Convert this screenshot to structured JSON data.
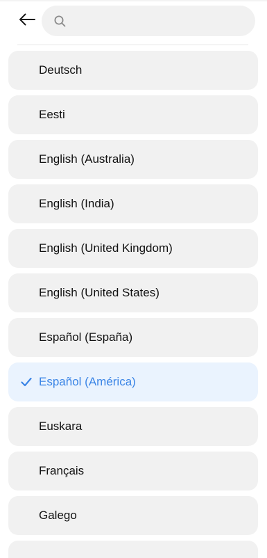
{
  "header": {
    "back_icon": "arrow-left-icon",
    "search": {
      "icon": "search-icon",
      "value": "",
      "placeholder": ""
    }
  },
  "colors": {
    "accent": "#3b85e6",
    "item_background": "#f1f1f1",
    "selected_background": "#eaf3fe"
  },
  "languages": [
    {
      "label": "Deutsch",
      "selected": false
    },
    {
      "label": "Eesti",
      "selected": false
    },
    {
      "label": "English (Australia)",
      "selected": false
    },
    {
      "label": "English (India)",
      "selected": false
    },
    {
      "label": "English (United Kingdom)",
      "selected": false
    },
    {
      "label": "English (United States)",
      "selected": false
    },
    {
      "label": "Español (España)",
      "selected": false
    },
    {
      "label": "Español (América)",
      "selected": true
    },
    {
      "label": "Euskara",
      "selected": false
    },
    {
      "label": "Français",
      "selected": false
    },
    {
      "label": "Galego",
      "selected": false
    },
    {
      "label": "",
      "selected": false
    }
  ],
  "selected_icon": "checkmark-icon"
}
